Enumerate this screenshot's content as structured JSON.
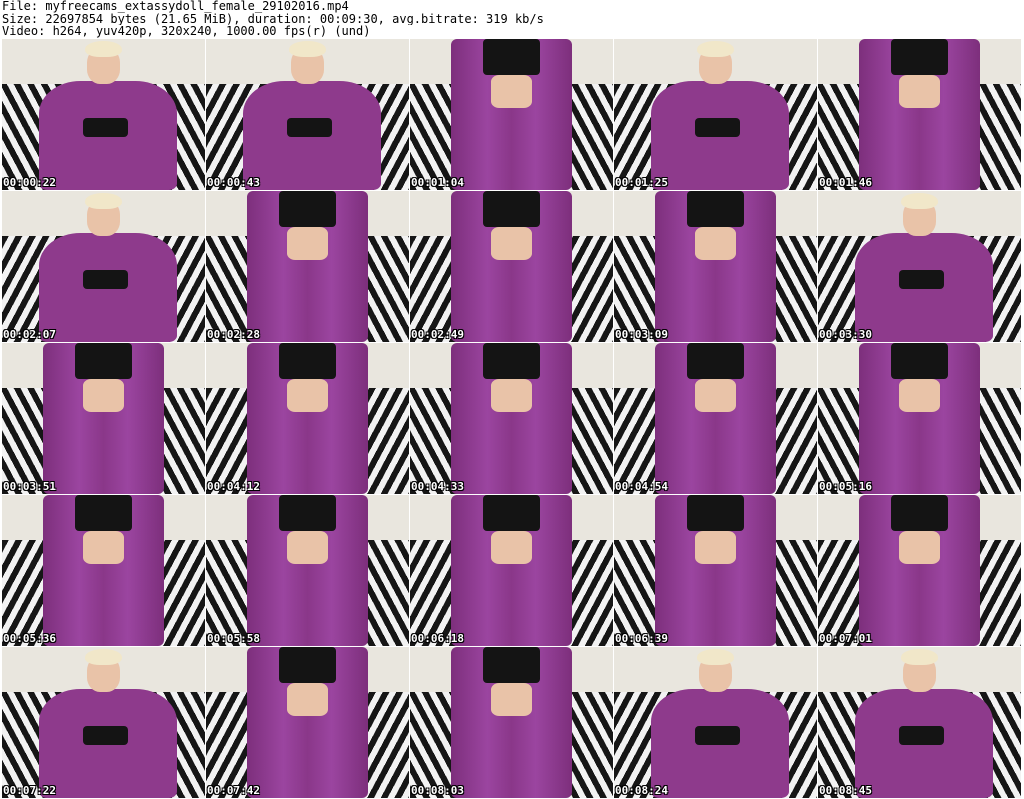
{
  "header": {
    "file_line": "File: myfreecams_extassydoll_female_29102016.mp4",
    "size_line": "Size: 22697854 bytes (21.65 MiB), duration: 00:09:30, avg.bitrate: 319 kb/s",
    "video_line": "Video: h264, yuv420p, 320x240, 1000.00 fps(r) (und)"
  },
  "thumbnails": [
    {
      "timestamp": "00:00:22",
      "pose": "seated"
    },
    {
      "timestamp": "00:00:43",
      "pose": "seated"
    },
    {
      "timestamp": "00:01:04",
      "pose": "standing"
    },
    {
      "timestamp": "00:01:25",
      "pose": "seated"
    },
    {
      "timestamp": "00:01:46",
      "pose": "standing"
    },
    {
      "timestamp": "00:02:07",
      "pose": "seated"
    },
    {
      "timestamp": "00:02:28",
      "pose": "standing"
    },
    {
      "timestamp": "00:02:49",
      "pose": "standing"
    },
    {
      "timestamp": "00:03:09",
      "pose": "standing"
    },
    {
      "timestamp": "00:03:30",
      "pose": "seated"
    },
    {
      "timestamp": "00:03:51",
      "pose": "standing"
    },
    {
      "timestamp": "00:04:12",
      "pose": "standing"
    },
    {
      "timestamp": "00:04:33",
      "pose": "standing"
    },
    {
      "timestamp": "00:04:54",
      "pose": "standing"
    },
    {
      "timestamp": "00:05:16",
      "pose": "standing"
    },
    {
      "timestamp": "00:05:36",
      "pose": "standing"
    },
    {
      "timestamp": "00:05:58",
      "pose": "standing"
    },
    {
      "timestamp": "00:06:18",
      "pose": "standing"
    },
    {
      "timestamp": "00:06:39",
      "pose": "standing"
    },
    {
      "timestamp": "00:07:01",
      "pose": "standing"
    },
    {
      "timestamp": "00:07:22",
      "pose": "seated"
    },
    {
      "timestamp": "00:07:42",
      "pose": "standing"
    },
    {
      "timestamp": "00:08:03",
      "pose": "standing"
    },
    {
      "timestamp": "00:08:24",
      "pose": "seated"
    },
    {
      "timestamp": "00:08:45",
      "pose": "seated"
    }
  ],
  "colors": {
    "background": "#ffffff",
    "robe": "#8e3a8c",
    "timestamp_text": "#ffffff"
  }
}
